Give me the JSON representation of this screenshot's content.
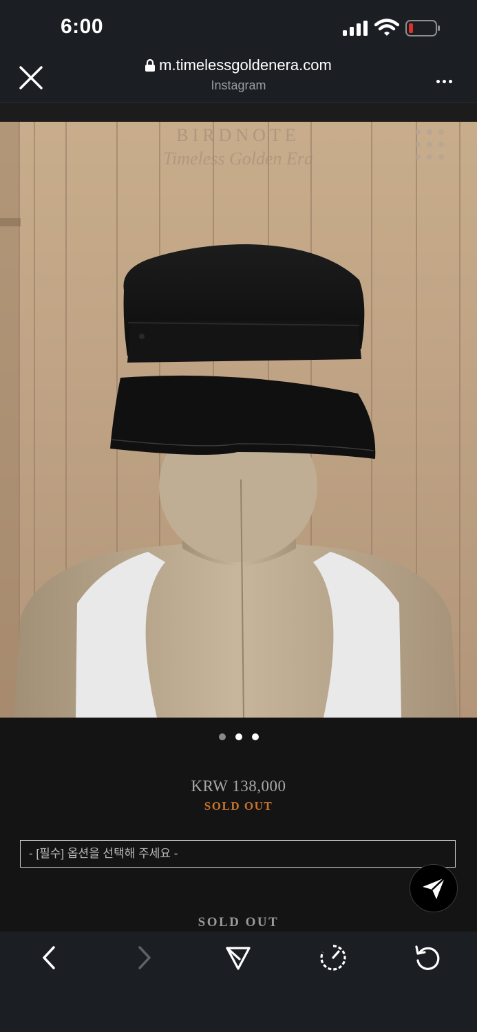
{
  "status_bar": {
    "time": "6:00"
  },
  "browser": {
    "url": "m.timelessgoldenera.com",
    "subtitle": "Instagram"
  },
  "photo": {
    "watermark_title": "BIRDNOTE",
    "watermark_script": "Timeless Golden Era"
  },
  "carousel": {
    "count": 3,
    "active_index": 0
  },
  "product": {
    "price": "KRW 138,000",
    "status": "SOLD OUT",
    "option_placeholder": "- [필수] 옵션을 선택해 주세요 -",
    "button_label": "SOLD OUT"
  },
  "colors": {
    "background": "#141414",
    "bar": "#1b1e22",
    "sold_out": "#c8742a",
    "battery_low": "#e0302a"
  },
  "icons": {
    "close": "close-icon",
    "lock": "lock-icon",
    "more": "more-icon",
    "share_fab": "paper-plane-icon",
    "back": "chevron-left-icon",
    "forward": "chevron-right-icon",
    "share": "send-icon",
    "speed": "gauge-icon",
    "reload": "reload-icon"
  }
}
